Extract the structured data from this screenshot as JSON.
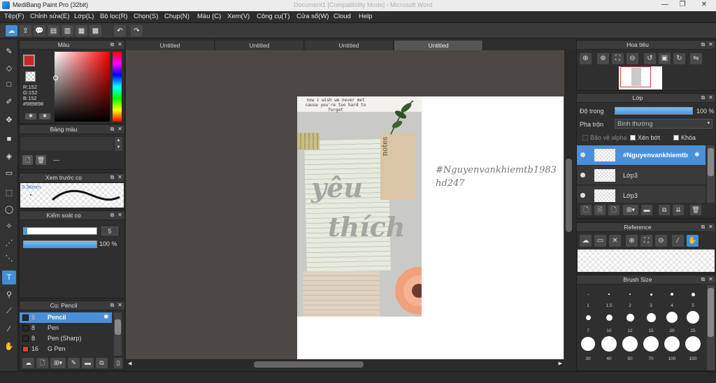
{
  "window": {
    "title": "MediBang Paint Pro (32bit)",
    "ghost_title": "Document1 [Compatibility Mode] - Microsoft Word",
    "controls": [
      "—",
      "❐",
      "✕"
    ]
  },
  "menu": [
    "Tệp(F)",
    "Chỉnh sửa(E)",
    "Lớp(L)",
    "Bộ lọc(R)",
    "Chọn(S)",
    "Chụp(N)",
    "Màu (C)",
    "Xem(V)",
    "Công cụ(T)",
    "Cửa sổ(W)",
    "Cloud",
    "Help"
  ],
  "tabs": [
    "Untitled",
    "Untitled",
    "Untitled",
    "Untitled"
  ],
  "color_panel": {
    "title": "Màu",
    "r": "R:152",
    "g": "G:152",
    "b": "B:152",
    "hex": "#989898",
    "primary": "#c62828",
    "current": "#989898"
  },
  "palette_panel": {
    "title": "Bảng màu",
    "dash": "---"
  },
  "brush_preview_panel": {
    "title": "Xem trước cọ",
    "size": "0.36mm"
  },
  "brush_control_panel": {
    "title": "Kiểm soát cọ",
    "size_value": "5",
    "opacity_value": "100 %",
    "opacity": 1.0,
    "size_fill": 0.05
  },
  "brush_panel": {
    "title": "Cọ: Pencil",
    "items": [
      {
        "size": "5",
        "name": "Pencil",
        "color": "#2b2b2b",
        "selected": true
      },
      {
        "size": "8",
        "name": "Pen",
        "color": "#2b2b2b",
        "selected": false
      },
      {
        "size": "8",
        "name": "Pen (Sharp)",
        "color": "#2b2b2b",
        "selected": false
      },
      {
        "size": "16",
        "name": "G Pen",
        "color": "#e53935",
        "selected": false
      }
    ]
  },
  "navigator_panel": {
    "title": "Hoa tiêu"
  },
  "layer_panel": {
    "title": "Lớp",
    "opacity_label": "Độ trong",
    "opacity_value": "100 %",
    "opacity": 1.0,
    "blend_label": "Pha trộn",
    "blend_value": "Bình thường",
    "alpha_label": "Bảo vệ alpha",
    "clip_label": "Xén bớt",
    "lock_label": "Khóa",
    "layers": [
      {
        "name": "#Nguyenvankhiemtb",
        "selected": true
      },
      {
        "name": "Lớp3",
        "selected": false
      },
      {
        "name": "Lớp3",
        "selected": false
      }
    ]
  },
  "reference_panel": {
    "title": "Reference"
  },
  "brush_size_panel": {
    "title": "Brush Size",
    "labels": [
      "1",
      "1.5",
      "2",
      "3",
      "4",
      "5",
      "7",
      "10",
      "12",
      "15",
      "20",
      "25",
      "30",
      "40",
      "50",
      "70",
      "100",
      "150"
    ]
  },
  "artwork": {
    "quote_line1": "now i wish we never met",
    "quote_line2": "cause you're too hard to forget",
    "big_word1": "yêu",
    "big_word2": "thích",
    "tag": "notes",
    "credit_line1": "#Nguyenvankhiemtb1983",
    "credit_line2": "hd247"
  }
}
